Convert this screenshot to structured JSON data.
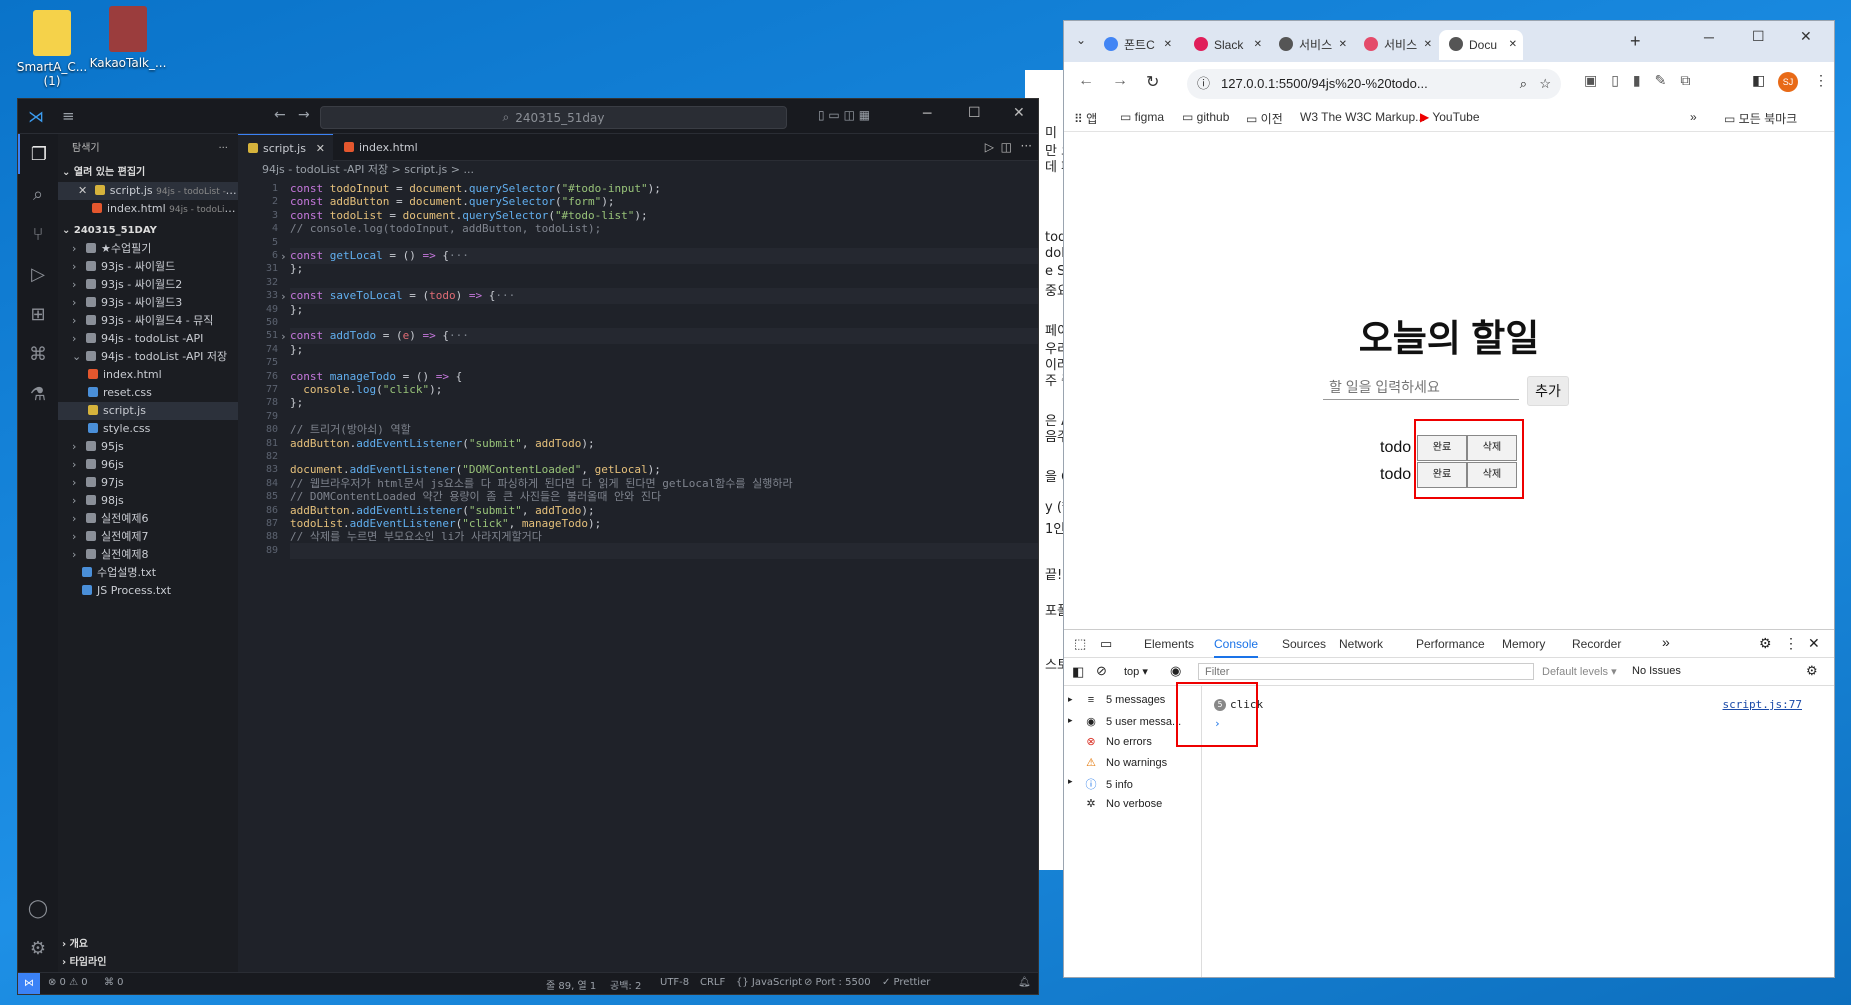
{
  "desktop": {
    "icons": [
      {
        "label": "SmartA_C...\n(1)",
        "color": "#f5d24a"
      },
      {
        "label": "KakaoTalk_...",
        "color": "#9b3d3d"
      }
    ]
  },
  "vscode": {
    "search": "240315_51day",
    "sidebar": {
      "title": "탐색기",
      "open_editors_label": "열려 있는 편집기",
      "open_editors": [
        {
          "name": "script.js",
          "sub": "94js - todoList -A..."
        },
        {
          "name": "index.html",
          "sub": "94js - todoList ..."
        }
      ],
      "workspace_label": "240315_51DAY",
      "tree": [
        "★수업필기",
        "93js - 싸이월드",
        "93js - 싸이월드2",
        "93js - 싸이월드3",
        "93js - 싸이월드4 - 뮤직",
        "94js - todoList -API",
        "94js - todoList -API 저장",
        "index.html",
        "reset.css",
        "script.js",
        "style.css",
        "95js",
        "96js",
        "97js",
        "98js",
        "실전예제6",
        "실전예제7",
        "실전예제8",
        "수업설명.txt",
        "JS Process.txt"
      ],
      "outline_label": "개요",
      "timeline_label": "타임라인"
    },
    "tabs": [
      {
        "label": "script.js"
      },
      {
        "label": "index.html"
      }
    ],
    "breadcrumb": "94js - todoList -API 저장 > script.js > ...",
    "lines": [
      {
        "n": "1",
        "fold": false,
        "html": "<span class='k'>const</span> <span class='v'>todoInput</span> = <span class='v'>document</span>.<span class='f'>querySelector</span>(<span class='s'>\"#todo-input\"</span>);"
      },
      {
        "n": "2",
        "fold": false,
        "html": "<span class='k'>const</span> <span class='v'>addButton</span> = <span class='v'>document</span>.<span class='f'>querySelector</span>(<span class='s'>\"form\"</span>);"
      },
      {
        "n": "3",
        "fold": false,
        "html": "<span class='k'>const</span> <span class='v'>todoList</span> = <span class='v'>document</span>.<span class='f'>querySelector</span>(<span class='s'>\"#todo-list\"</span>);"
      },
      {
        "n": "4",
        "fold": false,
        "html": "<span class='c'>// console.log(todoInput, addButton, todoList);</span>"
      },
      {
        "n": "5",
        "fold": false,
        "html": ""
      },
      {
        "n": "6",
        "fold": true,
        "html": "<span class='k'>const</span> <span class='f'>getLocal</span> = () <span class='k'>=&gt;</span> {<span class='c'>···</span>"
      },
      {
        "n": "31",
        "fold": false,
        "html": "};"
      },
      {
        "n": "32",
        "fold": false,
        "html": ""
      },
      {
        "n": "33",
        "fold": true,
        "html": "<span class='k'>const</span> <span class='f'>saveToLocal</span> = (<span class='p'>todo</span>) <span class='k'>=&gt;</span> {<span class='c'>···</span>"
      },
      {
        "n": "49",
        "fold": false,
        "html": "};"
      },
      {
        "n": "50",
        "fold": false,
        "html": ""
      },
      {
        "n": "51",
        "fold": true,
        "html": "<span class='k'>const</span> <span class='f'>addTodo</span> = (<span class='p'>e</span>) <span class='k'>=&gt;</span> {<span class='c'>···</span>"
      },
      {
        "n": "74",
        "fold": false,
        "html": "};"
      },
      {
        "n": "75",
        "fold": false,
        "html": ""
      },
      {
        "n": "76",
        "fold": false,
        "html": "<span class='k'>const</span> <span class='f'>manageTodo</span> = () <span class='k'>=&gt;</span> {"
      },
      {
        "n": "77",
        "fold": false,
        "html": "  <span class='v'>console</span>.<span class='f'>log</span>(<span class='s'>\"click\"</span>);"
      },
      {
        "n": "78",
        "fold": false,
        "html": "};"
      },
      {
        "n": "79",
        "fold": false,
        "html": ""
      },
      {
        "n": "80",
        "fold": false,
        "html": "<span class='c'>// 트리거(방아쇠) 역할</span>"
      },
      {
        "n": "81",
        "fold": false,
        "html": "<span class='v'>addButton</span>.<span class='f'>addEventListener</span>(<span class='s'>\"submit\"</span>, <span class='v'>addTodo</span>);"
      },
      {
        "n": "82",
        "fold": false,
        "html": ""
      },
      {
        "n": "83",
        "fold": false,
        "html": "<span class='v'>document</span>.<span class='f'>addEventListener</span>(<span class='s'>\"DOMContentLoaded\"</span>, <span class='v'>getLocal</span>);"
      },
      {
        "n": "84",
        "fold": false,
        "html": "<span class='c'>// 웹브라우저가 html문서 js요소를 다 파싱하게 된다면 다 읽게 된다면 getLocal함수를 실행하라</span>"
      },
      {
        "n": "85",
        "fold": false,
        "html": "<span class='c'>// DOMContentLoaded 약간 용량이 좀 큰 사진들은 불러올때 안와 진다</span>"
      },
      {
        "n": "86",
        "fold": false,
        "html": "<span class='v'>addButton</span>.<span class='f'>addEventListener</span>(<span class='s'>\"submit\"</span>, <span class='v'>addTodo</span>);"
      },
      {
        "n": "87",
        "fold": false,
        "html": "<span class='v'>todoList</span>.<span class='f'>addEventListener</span>(<span class='s'>\"click\"</span>, <span class='v'>manageTodo</span>);"
      },
      {
        "n": "88",
        "fold": false,
        "html": "<span class='c'>// 삭제를 누르면 부모요소인 li가 사라지게할거다</span>"
      },
      {
        "n": "89",
        "fold": false,
        "html": ""
      }
    ],
    "status": {
      "errors": "⊗ 0 ⚠ 0",
      "ports": "⌘ 0",
      "position": "줄 89, 열 1",
      "spaces": "공백: 2",
      "encoding": "UTF-8",
      "eol": "CRLF",
      "language": "{} JavaScript",
      "port": "⊘ Port : 5500",
      "prettier": "✓ Prettier"
    }
  },
  "chrome": {
    "tabs": [
      {
        "label": "폰트C",
        "color": "#4285f4"
      },
      {
        "label": "Slack",
        "color": "#e01e5a"
      },
      {
        "label": "서비스",
        "color": "#555555"
      },
      {
        "label": "서비스",
        "color": "#e44b6a"
      },
      {
        "label": "Docu",
        "color": "#555555"
      }
    ],
    "url": "127.0.0.1:5500/94js%20-%20todo...",
    "bookmarks": [
      "앱",
      "figma",
      "github",
      "이전",
      "The W3C Markup...",
      "YouTube"
    ],
    "all_bookmarks": "모든 북마크",
    "avatar": "SJ",
    "page": {
      "title": "오늘의 할일",
      "input_placeholder": "할 일을 입력하세요",
      "add_button": "추가",
      "todos": [
        {
          "text": "todo",
          "done": "완료",
          "delete": "삭제"
        },
        {
          "text": "todo",
          "done": "완료",
          "delete": "삭제"
        }
      ]
    },
    "devtools": {
      "tabs": [
        "Elements",
        "Console",
        "Sources",
        "Network",
        "Performance",
        "Memory",
        "Recorder"
      ],
      "context": "top",
      "filter_placeholder": "Filter",
      "levels": "Default levels ▾",
      "issues": "No Issues",
      "sidebar": [
        {
          "icon": "≡",
          "label": "5 messages"
        },
        {
          "icon": "◉",
          "label": "5 user messa..."
        },
        {
          "icon": "⊗",
          "label": "No errors"
        },
        {
          "icon": "⚠",
          "label": "No warnings"
        },
        {
          "icon": "ⓘ",
          "label": "5 info"
        },
        {
          "icon": "✲",
          "label": "No verbose"
        }
      ],
      "log": {
        "count": "5",
        "message": "click",
        "source": "script.js:77"
      }
    }
  },
  "background_doc": {
    "fragments": [
      "미",
      "만 오",
      "데 페",
      "tod",
      "dol",
      "e S",
      "중요",
      "페이",
      "우리",
      "이러",
      "주 중",
      "은 A",
      "음주",
      "을 O",
      "y (*",
      "1인",
      "끝!",
      "포폴",
      "스토"
    ]
  }
}
